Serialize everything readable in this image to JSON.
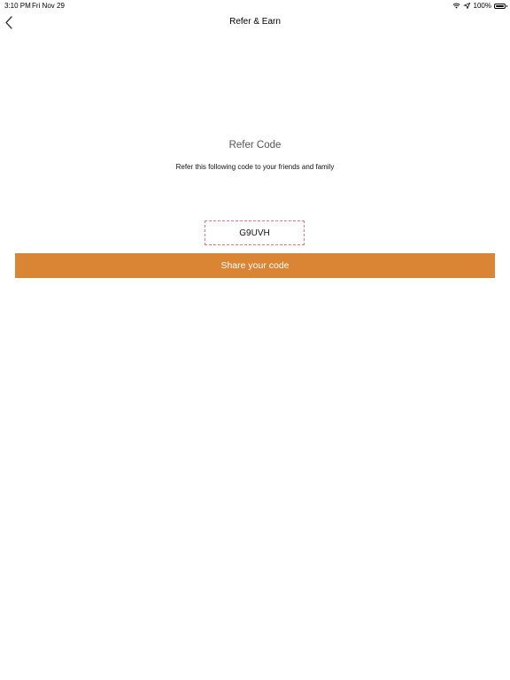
{
  "status_bar": {
    "time": "3:10 PM",
    "date": "Fri Nov 29",
    "battery": "100%",
    "icons": [
      "wifi-icon",
      "location-icon",
      "battery-icon"
    ]
  },
  "nav": {
    "title": "Refer & Earn",
    "back_icon": "chevron-left-icon"
  },
  "refer": {
    "title": "Refer Code",
    "subtitle": "Refer this following code to your friends and family",
    "code": "G9UVH",
    "share_label": "Share your code"
  },
  "colors": {
    "accent": "#d98534",
    "code_border": "#e8737a"
  }
}
